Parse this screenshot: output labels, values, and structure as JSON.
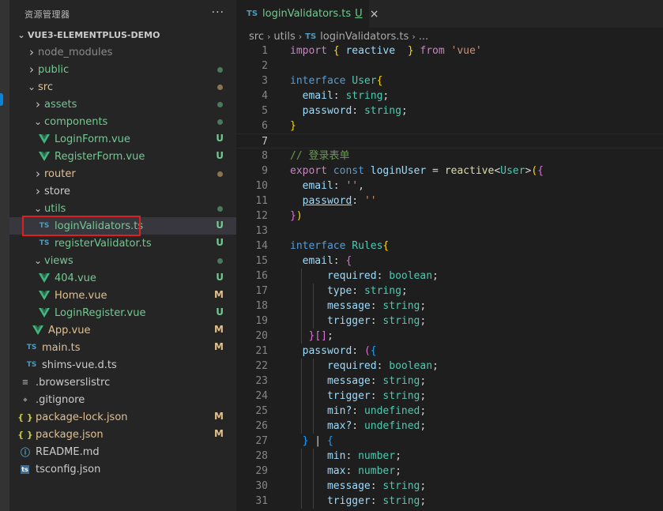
{
  "explorer": {
    "title": "资源管理器",
    "more_label": "···",
    "root_label": "VUE3-ELEMENTPLUS-DEMO",
    "items": [
      {
        "label": "node_modules",
        "kind": "folder",
        "expanded": false,
        "badge": "",
        "color": "#8c8c8c"
      },
      {
        "label": "public",
        "kind": "folder",
        "expanded": false,
        "badge": "dot-green",
        "color": "#73c991"
      },
      {
        "label": "src",
        "kind": "folder",
        "expanded": true,
        "badge": "dot-brown",
        "color": "#e2c08d"
      },
      {
        "label": "assets",
        "kind": "folder",
        "expanded": false,
        "badge": "dot-green",
        "color": "#73c991"
      },
      {
        "label": "components",
        "kind": "folder",
        "expanded": true,
        "badge": "dot-green",
        "color": "#73c991"
      },
      {
        "label": "LoginForm.vue",
        "kind": "vue",
        "badge": "U",
        "color": "#73c991"
      },
      {
        "label": "RegisterForm.vue",
        "kind": "vue",
        "badge": "U",
        "color": "#73c991"
      },
      {
        "label": "router",
        "kind": "folder",
        "expanded": false,
        "badge": "dot-brown",
        "color": "#e2c08d"
      },
      {
        "label": "store",
        "kind": "folder",
        "expanded": false,
        "badge": "",
        "color": "#cccccc"
      },
      {
        "label": "utils",
        "kind": "folder",
        "expanded": true,
        "badge": "dot-green",
        "color": "#73c991"
      },
      {
        "label": "loginValidators.ts",
        "kind": "ts",
        "badge": "U",
        "color": "#73c991",
        "selected": true
      },
      {
        "label": "registerValidator.ts",
        "kind": "ts",
        "badge": "U",
        "color": "#73c991"
      },
      {
        "label": "views",
        "kind": "folder",
        "expanded": true,
        "badge": "dot-green",
        "color": "#73c991"
      },
      {
        "label": "404.vue",
        "kind": "vue",
        "badge": "U",
        "color": "#73c991"
      },
      {
        "label": "Home.vue",
        "kind": "vue",
        "badge": "M",
        "color": "#e2c08d"
      },
      {
        "label": "LoginRegister.vue",
        "kind": "vue",
        "badge": "U",
        "color": "#73c991"
      },
      {
        "label": "App.vue",
        "kind": "vue",
        "badge": "M",
        "color": "#e2c08d"
      },
      {
        "label": "main.ts",
        "kind": "ts",
        "badge": "M",
        "color": "#e2c08d"
      },
      {
        "label": "shims-vue.d.ts",
        "kind": "ts",
        "badge": "",
        "color": "#cccccc"
      },
      {
        "label": ".browserslistrc",
        "kind": "lines",
        "badge": "",
        "color": "#cccccc"
      },
      {
        "label": ".gitignore",
        "kind": "git",
        "badge": "",
        "color": "#cccccc"
      },
      {
        "label": "package-lock.json",
        "kind": "json",
        "badge": "M",
        "color": "#e2c08d"
      },
      {
        "label": "package.json",
        "kind": "json",
        "badge": "M",
        "color": "#e2c08d"
      },
      {
        "label": "README.md",
        "kind": "info",
        "badge": "",
        "color": "#cccccc"
      },
      {
        "label": "tsconfig.json",
        "kind": "tsconfig",
        "badge": "",
        "color": "#cccccc"
      }
    ]
  },
  "tab": {
    "icon": "TS",
    "name": "loginValidators.ts",
    "status": "U",
    "close": "×"
  },
  "breadcrumb": {
    "parts": [
      "src",
      "utils"
    ],
    "file_icon": "TS",
    "file": "loginValidators.ts",
    "tail": "..."
  },
  "code": {
    "current_line": 7,
    "lines": [
      [
        [
          "import",
          "kc"
        ],
        [
          " ",
          "p"
        ],
        [
          "{",
          "b1"
        ],
        [
          " ",
          "p"
        ],
        [
          "reactive",
          "v"
        ],
        [
          "  ",
          "p"
        ],
        [
          "}",
          "b1"
        ],
        [
          " ",
          "p"
        ],
        [
          "from",
          "kc"
        ],
        [
          " ",
          "p"
        ],
        [
          "'vue'",
          "s"
        ]
      ],
      [],
      [
        [
          "interface",
          "k"
        ],
        [
          " ",
          "p"
        ],
        [
          "User",
          "t"
        ],
        [
          "{",
          "b1"
        ]
      ],
      [
        [
          "  ",
          "p"
        ],
        [
          "email",
          "v"
        ],
        [
          ": ",
          "p"
        ],
        [
          "string",
          "t"
        ],
        [
          ";",
          "p"
        ]
      ],
      [
        [
          "  ",
          "p"
        ],
        [
          "password",
          "v"
        ],
        [
          ": ",
          "p"
        ],
        [
          "string",
          "t"
        ],
        [
          ";",
          "p"
        ]
      ],
      [
        [
          "}",
          "b1"
        ]
      ],
      [],
      [
        [
          "// 登录表单",
          "c"
        ]
      ],
      [
        [
          "export",
          "kc"
        ],
        [
          " ",
          "p"
        ],
        [
          "const",
          "k"
        ],
        [
          " ",
          "p"
        ],
        [
          "loginUser",
          "v"
        ],
        [
          " = ",
          "p"
        ],
        [
          "reactive",
          "f"
        ],
        [
          "<",
          "p"
        ],
        [
          "User",
          "t"
        ],
        [
          ">",
          "p"
        ],
        [
          "(",
          "b1"
        ],
        [
          "{",
          "b2"
        ]
      ],
      [
        [
          "  ",
          "p"
        ],
        [
          "email",
          "v"
        ],
        [
          ": ",
          "p"
        ],
        [
          "''",
          "s"
        ],
        [
          ",",
          "p"
        ]
      ],
      [
        [
          "  ",
          "p"
        ],
        [
          "password",
          "v u"
        ],
        [
          ": ",
          "p"
        ],
        [
          "''",
          "s"
        ]
      ],
      [
        [
          "}",
          "b2"
        ],
        [
          ")",
          "b1"
        ]
      ],
      [],
      [
        [
          "interface",
          "k"
        ],
        [
          " ",
          "p"
        ],
        [
          "Rules",
          "t"
        ],
        [
          "{",
          "b1"
        ]
      ],
      [
        [
          "  ",
          "p"
        ],
        [
          "email",
          "v"
        ],
        [
          ": ",
          "p"
        ],
        [
          "{",
          "b2"
        ]
      ],
      [
        [
          "      ",
          "p"
        ],
        [
          "required",
          "v"
        ],
        [
          ": ",
          "p"
        ],
        [
          "boolean",
          "t"
        ],
        [
          ";",
          "p"
        ]
      ],
      [
        [
          "      ",
          "p"
        ],
        [
          "type",
          "v"
        ],
        [
          ": ",
          "p"
        ],
        [
          "string",
          "t"
        ],
        [
          ";",
          "p"
        ]
      ],
      [
        [
          "      ",
          "p"
        ],
        [
          "message",
          "v"
        ],
        [
          ": ",
          "p"
        ],
        [
          "string",
          "t"
        ],
        [
          ";",
          "p"
        ]
      ],
      [
        [
          "      ",
          "p"
        ],
        [
          "trigger",
          "v"
        ],
        [
          ": ",
          "p"
        ],
        [
          "string",
          "t"
        ],
        [
          ";",
          "p"
        ]
      ],
      [
        [
          "   ",
          "p"
        ],
        [
          "}",
          "b2"
        ],
        [
          "[]",
          "b2"
        ],
        [
          ";",
          "p"
        ]
      ],
      [
        [
          "  ",
          "p"
        ],
        [
          "password",
          "v"
        ],
        [
          ": ",
          "p"
        ],
        [
          "(",
          "b2"
        ],
        [
          "{",
          "b3"
        ]
      ],
      [
        [
          "      ",
          "p"
        ],
        [
          "required",
          "v"
        ],
        [
          ": ",
          "p"
        ],
        [
          "boolean",
          "t"
        ],
        [
          ";",
          "p"
        ]
      ],
      [
        [
          "      ",
          "p"
        ],
        [
          "message",
          "v"
        ],
        [
          ": ",
          "p"
        ],
        [
          "string",
          "t"
        ],
        [
          ";",
          "p"
        ]
      ],
      [
        [
          "      ",
          "p"
        ],
        [
          "trigger",
          "v"
        ],
        [
          ": ",
          "p"
        ],
        [
          "string",
          "t"
        ],
        [
          ";",
          "p"
        ]
      ],
      [
        [
          "      ",
          "p"
        ],
        [
          "min?",
          "v"
        ],
        [
          ": ",
          "p"
        ],
        [
          "undefined",
          "t"
        ],
        [
          ";",
          "p"
        ]
      ],
      [
        [
          "      ",
          "p"
        ],
        [
          "max?",
          "v"
        ],
        [
          ": ",
          "p"
        ],
        [
          "undefined",
          "t"
        ],
        [
          ";",
          "p"
        ]
      ],
      [
        [
          "  ",
          "p"
        ],
        [
          "}",
          "b3"
        ],
        [
          " | ",
          "p"
        ],
        [
          "{",
          "b3"
        ]
      ],
      [
        [
          "      ",
          "p"
        ],
        [
          "min",
          "v"
        ],
        [
          ": ",
          "p"
        ],
        [
          "number",
          "t"
        ],
        [
          ";",
          "p"
        ]
      ],
      [
        [
          "      ",
          "p"
        ],
        [
          "max",
          "v"
        ],
        [
          ": ",
          "p"
        ],
        [
          "number",
          "t"
        ],
        [
          ";",
          "p"
        ]
      ],
      [
        [
          "      ",
          "p"
        ],
        [
          "message",
          "v"
        ],
        [
          ": ",
          "p"
        ],
        [
          "string",
          "t"
        ],
        [
          ";",
          "p"
        ]
      ],
      [
        [
          "      ",
          "p"
        ],
        [
          "trigger",
          "v"
        ],
        [
          ": ",
          "p"
        ],
        [
          "string",
          "t"
        ],
        [
          ";",
          "p"
        ]
      ]
    ]
  }
}
